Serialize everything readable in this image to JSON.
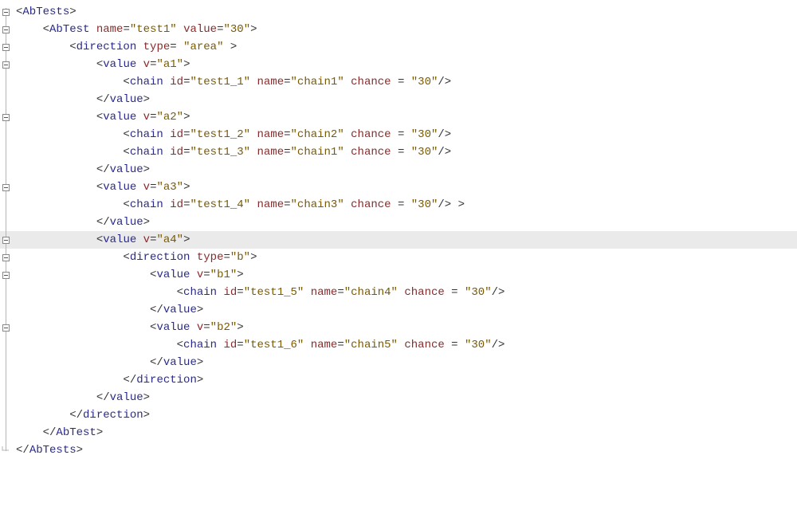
{
  "editor": {
    "highlighted_index": 13,
    "fold_rows": [
      0,
      1,
      2,
      3,
      6,
      10,
      13,
      14,
      15,
      18
    ],
    "corner_row": 25,
    "lines": [
      {
        "indent": 0,
        "tokens": [
          {
            "k": "pun",
            "t": "<"
          },
          {
            "k": "tag",
            "t": "AbTests"
          },
          {
            "k": "pun",
            "t": ">"
          }
        ]
      },
      {
        "indent": 1,
        "tokens": [
          {
            "k": "pun",
            "t": "<"
          },
          {
            "k": "tag",
            "t": "AbTest"
          },
          {
            "k": "pun",
            "t": " "
          },
          {
            "k": "attr",
            "t": "name"
          },
          {
            "k": "pun",
            "t": "="
          },
          {
            "k": "val",
            "t": "\"test1\""
          },
          {
            "k": "pun",
            "t": " "
          },
          {
            "k": "attr",
            "t": "value"
          },
          {
            "k": "pun",
            "t": "="
          },
          {
            "k": "val",
            "t": "\"30\""
          },
          {
            "k": "pun",
            "t": ">"
          }
        ]
      },
      {
        "indent": 2,
        "tokens": [
          {
            "k": "pun",
            "t": "<"
          },
          {
            "k": "tag",
            "t": "direction"
          },
          {
            "k": "pun",
            "t": " "
          },
          {
            "k": "attr",
            "t": "type"
          },
          {
            "k": "pun",
            "t": "= "
          },
          {
            "k": "val",
            "t": "\"area\""
          },
          {
            "k": "pun",
            "t": " >"
          }
        ]
      },
      {
        "indent": 3,
        "tokens": [
          {
            "k": "pun",
            "t": "<"
          },
          {
            "k": "tag",
            "t": "value"
          },
          {
            "k": "pun",
            "t": " "
          },
          {
            "k": "attr",
            "t": "v"
          },
          {
            "k": "pun",
            "t": "="
          },
          {
            "k": "val",
            "t": "\"a1\""
          },
          {
            "k": "pun",
            "t": ">"
          }
        ]
      },
      {
        "indent": 4,
        "tokens": [
          {
            "k": "pun",
            "t": "<"
          },
          {
            "k": "tag",
            "t": "chain"
          },
          {
            "k": "pun",
            "t": " "
          },
          {
            "k": "attr",
            "t": "id"
          },
          {
            "k": "pun",
            "t": "="
          },
          {
            "k": "val",
            "t": "\"test1_1\""
          },
          {
            "k": "pun",
            "t": " "
          },
          {
            "k": "attr",
            "t": "name"
          },
          {
            "k": "pun",
            "t": "="
          },
          {
            "k": "val",
            "t": "\"chain1\""
          },
          {
            "k": "pun",
            "t": " "
          },
          {
            "k": "attr",
            "t": "chance"
          },
          {
            "k": "pun",
            "t": " = "
          },
          {
            "k": "val",
            "t": "\"30\""
          },
          {
            "k": "pun",
            "t": "/>"
          }
        ]
      },
      {
        "indent": 3,
        "tokens": [
          {
            "k": "pun",
            "t": "</"
          },
          {
            "k": "tag",
            "t": "value"
          },
          {
            "k": "pun",
            "t": ">"
          }
        ]
      },
      {
        "indent": 3,
        "tokens": [
          {
            "k": "pun",
            "t": "<"
          },
          {
            "k": "tag",
            "t": "value"
          },
          {
            "k": "pun",
            "t": " "
          },
          {
            "k": "attr",
            "t": "v"
          },
          {
            "k": "pun",
            "t": "="
          },
          {
            "k": "val",
            "t": "\"a2\""
          },
          {
            "k": "pun",
            "t": ">"
          }
        ]
      },
      {
        "indent": 4,
        "tokens": [
          {
            "k": "pun",
            "t": "<"
          },
          {
            "k": "tag",
            "t": "chain"
          },
          {
            "k": "pun",
            "t": " "
          },
          {
            "k": "attr",
            "t": "id"
          },
          {
            "k": "pun",
            "t": "="
          },
          {
            "k": "val",
            "t": "\"test1_2\""
          },
          {
            "k": "pun",
            "t": " "
          },
          {
            "k": "attr",
            "t": "name"
          },
          {
            "k": "pun",
            "t": "="
          },
          {
            "k": "val",
            "t": "\"chain2\""
          },
          {
            "k": "pun",
            "t": " "
          },
          {
            "k": "attr",
            "t": "chance"
          },
          {
            "k": "pun",
            "t": " = "
          },
          {
            "k": "val",
            "t": "\"30\""
          },
          {
            "k": "pun",
            "t": "/>"
          }
        ]
      },
      {
        "indent": 4,
        "tokens": [
          {
            "k": "pun",
            "t": "<"
          },
          {
            "k": "tag",
            "t": "chain"
          },
          {
            "k": "pun",
            "t": " "
          },
          {
            "k": "attr",
            "t": "id"
          },
          {
            "k": "pun",
            "t": "="
          },
          {
            "k": "val",
            "t": "\"test1_3\""
          },
          {
            "k": "pun",
            "t": " "
          },
          {
            "k": "attr",
            "t": "name"
          },
          {
            "k": "pun",
            "t": "="
          },
          {
            "k": "val",
            "t": "\"chain1\""
          },
          {
            "k": "pun",
            "t": " "
          },
          {
            "k": "attr",
            "t": "chance"
          },
          {
            "k": "pun",
            "t": " = "
          },
          {
            "k": "val",
            "t": "\"30\""
          },
          {
            "k": "pun",
            "t": "/>"
          }
        ]
      },
      {
        "indent": 3,
        "tokens": [
          {
            "k": "pun",
            "t": "</"
          },
          {
            "k": "tag",
            "t": "value"
          },
          {
            "k": "pun",
            "t": ">"
          }
        ]
      },
      {
        "indent": 3,
        "tokens": [
          {
            "k": "pun",
            "t": "<"
          },
          {
            "k": "tag",
            "t": "value"
          },
          {
            "k": "pun",
            "t": " "
          },
          {
            "k": "attr",
            "t": "v"
          },
          {
            "k": "pun",
            "t": "="
          },
          {
            "k": "val",
            "t": "\"a3\""
          },
          {
            "k": "pun",
            "t": ">"
          }
        ]
      },
      {
        "indent": 4,
        "tokens": [
          {
            "k": "pun",
            "t": "<"
          },
          {
            "k": "tag",
            "t": "chain"
          },
          {
            "k": "pun",
            "t": " "
          },
          {
            "k": "attr",
            "t": "id"
          },
          {
            "k": "pun",
            "t": "="
          },
          {
            "k": "val",
            "t": "\"test1_4\""
          },
          {
            "k": "pun",
            "t": " "
          },
          {
            "k": "attr",
            "t": "name"
          },
          {
            "k": "pun",
            "t": "="
          },
          {
            "k": "val",
            "t": "\"chain3\""
          },
          {
            "k": "pun",
            "t": " "
          },
          {
            "k": "attr",
            "t": "chance"
          },
          {
            "k": "pun",
            "t": " = "
          },
          {
            "k": "val",
            "t": "\"30\""
          },
          {
            "k": "pun",
            "t": "/> >"
          }
        ]
      },
      {
        "indent": 3,
        "tokens": [
          {
            "k": "pun",
            "t": "</"
          },
          {
            "k": "tag",
            "t": "value"
          },
          {
            "k": "pun",
            "t": ">"
          }
        ]
      },
      {
        "indent": 3,
        "tokens": [
          {
            "k": "pun",
            "t": "<"
          },
          {
            "k": "tag",
            "t": "value"
          },
          {
            "k": "pun",
            "t": " "
          },
          {
            "k": "attr",
            "t": "v"
          },
          {
            "k": "pun",
            "t": "="
          },
          {
            "k": "val",
            "t": "\"a4\""
          },
          {
            "k": "pun",
            "t": ">"
          }
        ]
      },
      {
        "indent": 4,
        "tokens": [
          {
            "k": "pun",
            "t": "<"
          },
          {
            "k": "tag",
            "t": "direction"
          },
          {
            "k": "pun",
            "t": " "
          },
          {
            "k": "attr",
            "t": "type"
          },
          {
            "k": "pun",
            "t": "="
          },
          {
            "k": "val",
            "t": "\"b\""
          },
          {
            "k": "pun",
            "t": ">"
          }
        ]
      },
      {
        "indent": 5,
        "tokens": [
          {
            "k": "pun",
            "t": "<"
          },
          {
            "k": "tag",
            "t": "value"
          },
          {
            "k": "pun",
            "t": " "
          },
          {
            "k": "attr",
            "t": "v"
          },
          {
            "k": "pun",
            "t": "="
          },
          {
            "k": "val",
            "t": "\"b1\""
          },
          {
            "k": "pun",
            "t": ">"
          }
        ]
      },
      {
        "indent": 6,
        "tokens": [
          {
            "k": "pun",
            "t": "<"
          },
          {
            "k": "tag",
            "t": "chain"
          },
          {
            "k": "pun",
            "t": " "
          },
          {
            "k": "attr",
            "t": "id"
          },
          {
            "k": "pun",
            "t": "="
          },
          {
            "k": "val",
            "t": "\"test1_5\""
          },
          {
            "k": "pun",
            "t": " "
          },
          {
            "k": "attr",
            "t": "name"
          },
          {
            "k": "pun",
            "t": "="
          },
          {
            "k": "val",
            "t": "\"chain4\""
          },
          {
            "k": "pun",
            "t": " "
          },
          {
            "k": "attr",
            "t": "chance"
          },
          {
            "k": "pun",
            "t": " = "
          },
          {
            "k": "val",
            "t": "\"30\""
          },
          {
            "k": "pun",
            "t": "/>"
          }
        ]
      },
      {
        "indent": 5,
        "tokens": [
          {
            "k": "pun",
            "t": "</"
          },
          {
            "k": "tag",
            "t": "value"
          },
          {
            "k": "pun",
            "t": ">"
          }
        ]
      },
      {
        "indent": 5,
        "tokens": [
          {
            "k": "pun",
            "t": "<"
          },
          {
            "k": "tag",
            "t": "value"
          },
          {
            "k": "pun",
            "t": " "
          },
          {
            "k": "attr",
            "t": "v"
          },
          {
            "k": "pun",
            "t": "="
          },
          {
            "k": "val",
            "t": "\"b2\""
          },
          {
            "k": "pun",
            "t": ">"
          }
        ]
      },
      {
        "indent": 6,
        "tokens": [
          {
            "k": "pun",
            "t": "<"
          },
          {
            "k": "tag",
            "t": "chain"
          },
          {
            "k": "pun",
            "t": " "
          },
          {
            "k": "attr",
            "t": "id"
          },
          {
            "k": "pun",
            "t": "="
          },
          {
            "k": "val",
            "t": "\"test1_6\""
          },
          {
            "k": "pun",
            "t": " "
          },
          {
            "k": "attr",
            "t": "name"
          },
          {
            "k": "pun",
            "t": "="
          },
          {
            "k": "val",
            "t": "\"chain5\""
          },
          {
            "k": "pun",
            "t": " "
          },
          {
            "k": "attr",
            "t": "chance"
          },
          {
            "k": "pun",
            "t": " = "
          },
          {
            "k": "val",
            "t": "\"30\""
          },
          {
            "k": "pun",
            "t": "/>"
          }
        ]
      },
      {
        "indent": 5,
        "tokens": [
          {
            "k": "pun",
            "t": "</"
          },
          {
            "k": "tag",
            "t": "value"
          },
          {
            "k": "pun",
            "t": ">"
          }
        ]
      },
      {
        "indent": 4,
        "tokens": [
          {
            "k": "pun",
            "t": "</"
          },
          {
            "k": "tag",
            "t": "direction"
          },
          {
            "k": "pun",
            "t": ">"
          }
        ]
      },
      {
        "indent": 3,
        "tokens": [
          {
            "k": "pun",
            "t": "</"
          },
          {
            "k": "tag",
            "t": "value"
          },
          {
            "k": "pun",
            "t": ">"
          }
        ]
      },
      {
        "indent": 2,
        "tokens": [
          {
            "k": "pun",
            "t": "</"
          },
          {
            "k": "tag",
            "t": "direction"
          },
          {
            "k": "pun",
            "t": ">"
          }
        ]
      },
      {
        "indent": 1,
        "tokens": [
          {
            "k": "pun",
            "t": "</"
          },
          {
            "k": "tag",
            "t": "AbTest"
          },
          {
            "k": "pun",
            "t": ">"
          }
        ]
      },
      {
        "indent": 0,
        "tokens": [
          {
            "k": "pun",
            "t": "</"
          },
          {
            "k": "tag",
            "t": "AbTests"
          },
          {
            "k": "pun",
            "t": ">"
          }
        ]
      }
    ]
  }
}
